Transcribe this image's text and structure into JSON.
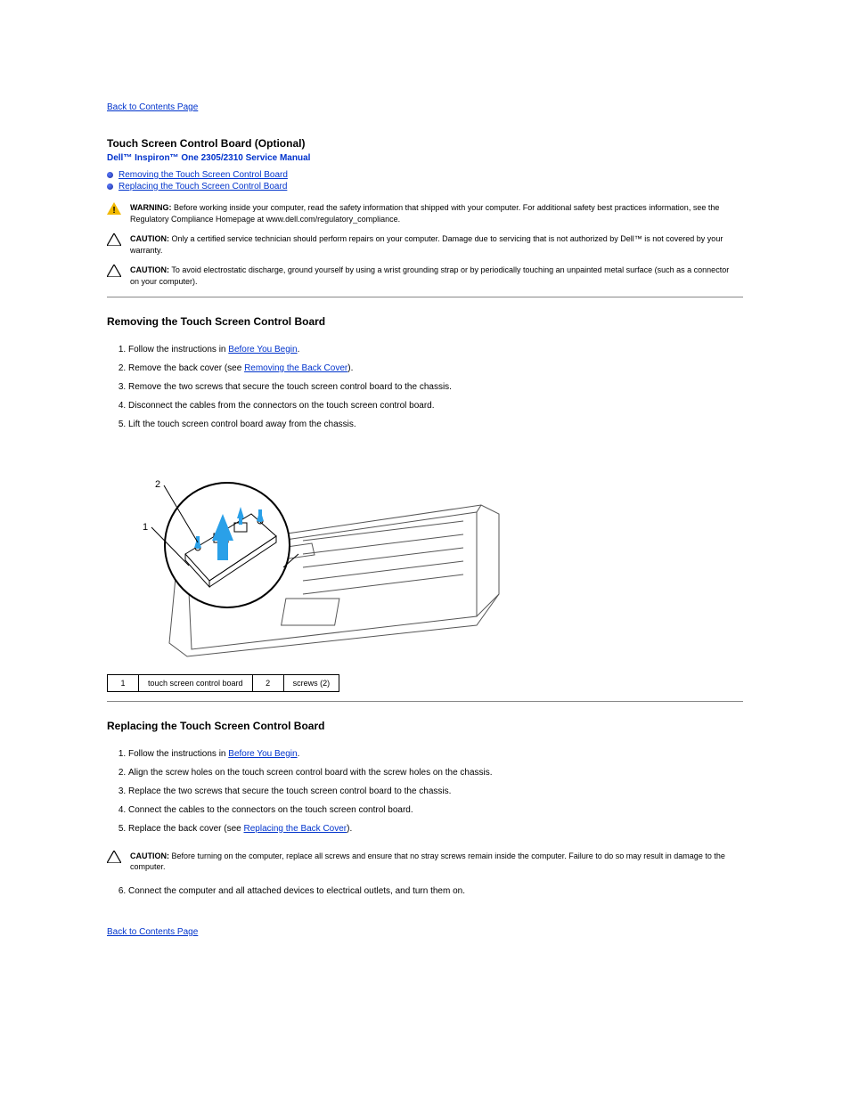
{
  "nav": {
    "back": "Back to Contents Page"
  },
  "title_block": {
    "title": "Touch Screen Control Board (Optional)",
    "manual_line": "Dell™ Inspiron™ One 2305/2310 Service Manual"
  },
  "toc_links": {
    "remove": "Removing the Touch Screen Control Board",
    "replace": "Replacing the Touch Screen Control Board"
  },
  "admon": {
    "warning_label": "WARNING:",
    "warning_text": "Before working inside your computer, read the safety information that shipped with your computer. For additional safety best practices information, see the Regulatory Compliance Homepage at www.dell.com/regulatory_compliance.",
    "caution1_label": "CAUTION:",
    "caution1_text": "Only a certified service technician should perform repairs on your computer. Damage due to servicing that is not authorized by Dell™ is not covered by your warranty.",
    "caution2_label": "CAUTION:",
    "caution2_text": "To avoid electrostatic discharge, ground yourself by using a wrist grounding strap or by periodically touching an unpainted metal surface (such as a connector on your computer).",
    "final_caution_label": "CAUTION:",
    "final_caution_text": "Before turning on the computer, replace all screws and ensure that no stray screws remain inside the computer. Failure to do so may result in damage to the computer."
  },
  "sections": {
    "remove": {
      "heading": "Removing the Touch Screen Control Board",
      "steps": [
        {
          "pre": "Follow the instructions in ",
          "link": "Before You Begin",
          "post": "."
        },
        {
          "pre": "Remove the back cover (see ",
          "link": "Removing the Back Cover",
          "post": ")."
        },
        {
          "pre": "Remove the two screws that secure the touch screen control board to the chassis.",
          "link": "",
          "post": ""
        },
        {
          "pre": "Disconnect the cables from the connectors on the touch screen control board.",
          "link": "",
          "post": ""
        },
        {
          "pre": "Lift the touch screen control board away from the chassis.",
          "link": "",
          "post": ""
        }
      ]
    },
    "replace": {
      "heading": "Replacing the Touch Screen Control Board",
      "steps": [
        {
          "pre": "Follow the instructions in ",
          "link": "Before You Begin",
          "post": "."
        },
        {
          "pre": "Align the screw holes on the touch screen control board with the screw holes on the chassis.",
          "link": "",
          "post": ""
        },
        {
          "pre": "Replace the two screws that secure the touch screen control board to the chassis.",
          "link": "",
          "post": ""
        },
        {
          "pre": "Connect the cables to the connectors on the touch screen control board.",
          "link": "",
          "post": ""
        },
        {
          "pre": "Replace the back cover (see ",
          "link": "Replacing the Back Cover",
          "post": ")."
        }
      ]
    }
  },
  "callouts": {
    "c1n": "1",
    "c1t": "touch screen control board",
    "c2n": "2",
    "c2t": "screws (2)"
  },
  "figure_labels": {
    "l1": "1",
    "l2": "2"
  }
}
